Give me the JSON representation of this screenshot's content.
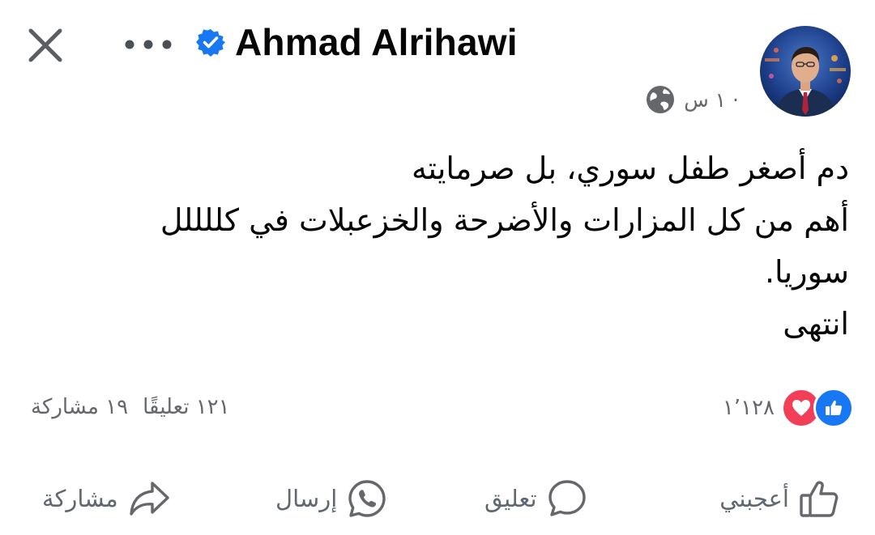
{
  "header": {
    "author_name": "Ahmad Alrihawi",
    "close_icon": "close-icon",
    "more_icon": "more-dots-icon",
    "verified_icon": "verified-badge-icon",
    "verified_color": "#1877f2"
  },
  "post": {
    "time": "١ س ·",
    "privacy_icon": "globe-icon",
    "lines": [
      "دم أصغر طفل سوري، بل صرمايته",
      "أهم من كل المزارات والأضرحة والخزعبلات في كللللل",
      "سوريا.",
      "انتهى"
    ]
  },
  "stats": {
    "reactions_count": "١٬١٢٨",
    "reaction_icons": [
      "like-reaction-icon",
      "love-reaction-icon"
    ],
    "comments": "١٢١ تعليقًا",
    "shares": "١٩ مشاركة"
  },
  "actions": {
    "like": "أعجبني",
    "comment": "تعليق",
    "send": "إرسال",
    "share": "مشاركة"
  },
  "colors": {
    "text": "#050505",
    "secondary": "#65676b",
    "like_blue": "#1877f2",
    "love_red": "#f33e58"
  }
}
